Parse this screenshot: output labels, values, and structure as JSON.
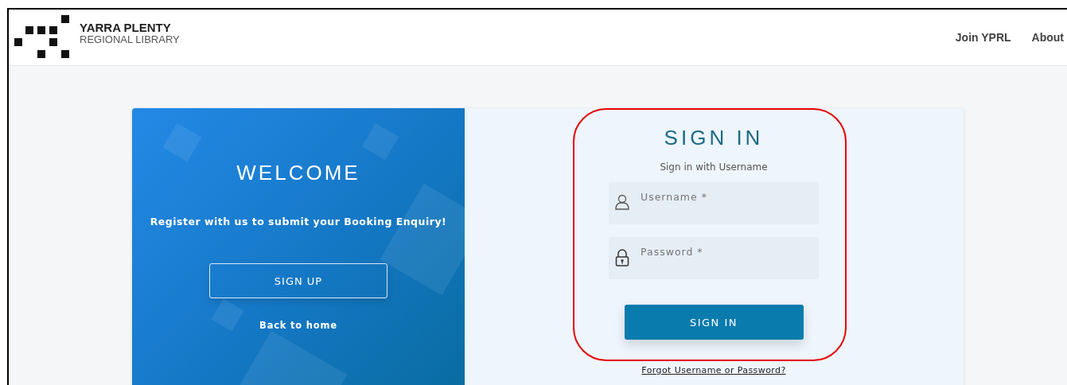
{
  "header": {
    "logo": {
      "line1": "YARRA PLENTY",
      "line2": "REGIONAL LIBRARY"
    },
    "nav": [
      {
        "label": "Join YPRL"
      },
      {
        "label": "About"
      }
    ]
  },
  "welcome_panel": {
    "title": "WELCOME",
    "message": "Register with us to submit your Booking Enquiry!",
    "signup_button": "SIGN UP",
    "back_link": "Back to home"
  },
  "sign_in_panel": {
    "title": "SIGN IN",
    "subtitle": "Sign in with Username",
    "fields": [
      {
        "kind": "user",
        "placeholder": "Username *"
      },
      {
        "kind": "lock",
        "placeholder": "Password *"
      }
    ],
    "submit_button": "SIGN IN",
    "forgot_link": "Forgot Username or Password?",
    "highlighted": true
  }
}
